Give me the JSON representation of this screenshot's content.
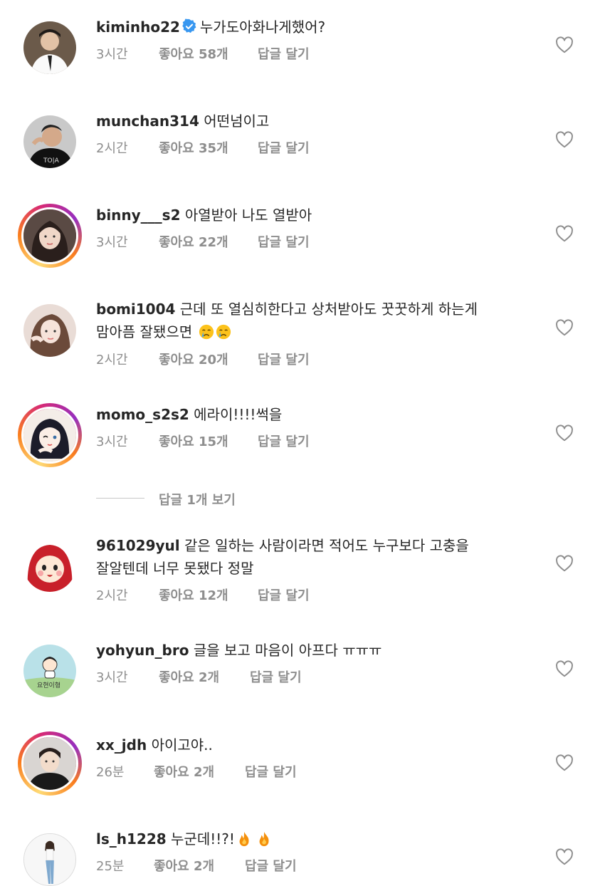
{
  "comments": [
    {
      "username": "kiminho22",
      "verified": true,
      "text": "누가도아화나게했어?",
      "text2": "",
      "time": "3시간",
      "likes": "좋아요 58개",
      "reply": "답글 달기",
      "story": false
    },
    {
      "username": "munchan314",
      "verified": false,
      "text": "어떤넘이고",
      "text2": "",
      "time": "2시간",
      "likes": "좋아요 35개",
      "reply": "답글 달기",
      "story": false
    },
    {
      "username": "binny___s2",
      "verified": false,
      "text": "아열받아 나도 열받아",
      "text2": "",
      "time": "3시간",
      "likes": "좋아요 22개",
      "reply": "답글 달기",
      "story": true
    },
    {
      "username": "bomi1004",
      "verified": false,
      "text": "근데 또 열심히한다고 상처받아도 꿋꿋하게 하는게",
      "text2": "맘아픔 잘됐으면",
      "emoji": "crying-face-emoji x2",
      "time": "2시간",
      "likes": "좋아요 20개",
      "reply": "답글 달기",
      "story": false
    },
    {
      "username": "momo_s2s2",
      "verified": false,
      "text": "에라이!!!!썩을",
      "text2": "",
      "time": "3시간",
      "likes": "좋아요 15개",
      "reply": "답글 달기",
      "story": true
    },
    {
      "username": "961029yul",
      "verified": false,
      "text": "같은 일하는 사람이라면 적어도 누구보다 고충을",
      "text2": "잘알텐데 너무 못됐다 정말",
      "time": "2시간",
      "likes": "좋아요 12개",
      "reply": "답글 달기",
      "story": false
    },
    {
      "username": "yohyun_bro",
      "verified": false,
      "text": "글을 보고 마음이 아프다 ㅠㅠㅠ",
      "text2": "",
      "time": "3시간",
      "likes": "좋아요 2개",
      "reply": "답글 달기",
      "story": false
    },
    {
      "username": "xx_jdh",
      "verified": false,
      "text": "아이고야..",
      "text2": "",
      "time": "26분",
      "likes": "좋아요 2개",
      "reply": "답글 달기",
      "story": true
    },
    {
      "username": "ls_h1228",
      "verified": false,
      "text": "누군데!!?!",
      "emoji": "fire-emoji x2",
      "text2": "",
      "time": "25분",
      "likes": "좋아요 2개",
      "reply": "답글 달기",
      "story": false
    }
  ],
  "view_replies": "답글 1개 보기",
  "colors": {
    "text": "#262626",
    "secondary": "#8e8e8e",
    "verified": "#3897f0",
    "story_ring": "#d62976"
  }
}
